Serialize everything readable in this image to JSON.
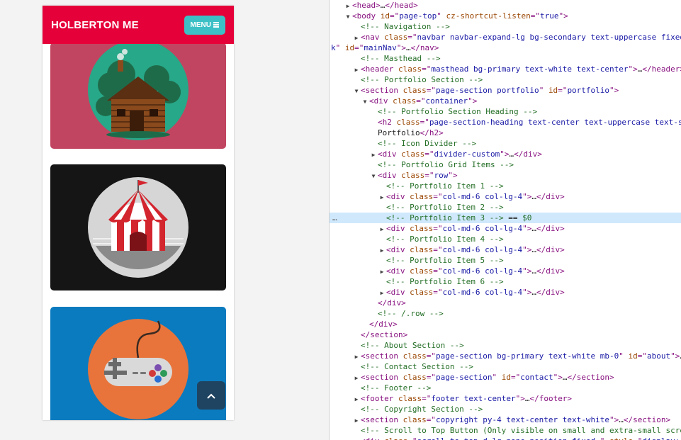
{
  "viewport": {
    "brand": "HOLBERTON ME",
    "menu_label": "MENU",
    "scroll_top_icon": "chevron-up-icon",
    "cards": [
      {
        "name": "cabin",
        "bg": "#c14561",
        "circle": "#27a888"
      },
      {
        "name": "circus",
        "bg": "#151515",
        "circle": "#d6d6d6"
      },
      {
        "name": "game-controller",
        "bg": "#0b7bbf",
        "circle": "#e8743b"
      }
    ]
  },
  "dom_lines": [
    {
      "indent": 1,
      "tw": "▶",
      "html": [
        [
          "tag",
          "<head>"
        ],
        [
          "txt",
          "…"
        ],
        [
          "tag",
          "</head>"
        ]
      ]
    },
    {
      "indent": 1,
      "tw": "▼",
      "html": [
        [
          "tag",
          "<body "
        ],
        [
          "attr",
          "id"
        ],
        [
          "tag",
          "=\""
        ],
        [
          "val",
          "page-top"
        ],
        [
          "tag",
          "\" "
        ],
        [
          "attr",
          "cz-shortcut-listen"
        ],
        [
          "tag",
          "=\""
        ],
        [
          "val",
          "true"
        ],
        [
          "tag",
          "\">"
        ]
      ]
    },
    {
      "indent": 2,
      "tw": "",
      "html": [
        [
          "cmt",
          "<!-- Navigation -->"
        ]
      ]
    },
    {
      "indent": 2,
      "tw": "▶",
      "html": [
        [
          "tag",
          "<nav "
        ],
        [
          "attr",
          "class"
        ],
        [
          "tag",
          "=\""
        ],
        [
          "val",
          "navbar navbar-expand-lg bg-secondary text-uppercase fixed-"
        ]
      ]
    },
    {
      "indent": 0,
      "tw": "",
      "html": [
        [
          "val",
          "k"
        ],
        [
          "tag",
          "\" "
        ],
        [
          "attr",
          "id"
        ],
        [
          "tag",
          "=\""
        ],
        [
          "val",
          "mainNav"
        ],
        [
          "tag",
          "\">"
        ],
        [
          "txt",
          "…"
        ],
        [
          "tag",
          "</nav>"
        ]
      ],
      "pad": 2
    },
    {
      "indent": 2,
      "tw": "",
      "html": [
        [
          "cmt",
          "<!-- Masthead -->"
        ]
      ]
    },
    {
      "indent": 2,
      "tw": "▶",
      "html": [
        [
          "tag",
          "<header "
        ],
        [
          "attr",
          "class"
        ],
        [
          "tag",
          "=\""
        ],
        [
          "val",
          "masthead bg-primary text-white text-center"
        ],
        [
          "tag",
          "\">"
        ],
        [
          "txt",
          "…"
        ],
        [
          "tag",
          "</header>"
        ]
      ]
    },
    {
      "indent": 2,
      "tw": "",
      "html": [
        [
          "cmt",
          "<!-- Portfolio Section -->"
        ]
      ]
    },
    {
      "indent": 2,
      "tw": "▼",
      "html": [
        [
          "tag",
          "<section "
        ],
        [
          "attr",
          "class"
        ],
        [
          "tag",
          "=\""
        ],
        [
          "val",
          "page-section portfolio"
        ],
        [
          "tag",
          "\" "
        ],
        [
          "attr",
          "id"
        ],
        [
          "tag",
          "=\""
        ],
        [
          "val",
          "portfolio"
        ],
        [
          "tag",
          "\">"
        ]
      ]
    },
    {
      "indent": 3,
      "tw": "▼",
      "html": [
        [
          "tag",
          "<div "
        ],
        [
          "attr",
          "class"
        ],
        [
          "tag",
          "=\""
        ],
        [
          "val",
          "container"
        ],
        [
          "tag",
          "\">"
        ]
      ]
    },
    {
      "indent": 4,
      "tw": "",
      "html": [
        [
          "cmt",
          "<!-- Portfolio Section Heading -->"
        ]
      ]
    },
    {
      "indent": 4,
      "tw": "",
      "html": [
        [
          "tag",
          "<h2 "
        ],
        [
          "attr",
          "class"
        ],
        [
          "tag",
          "=\""
        ],
        [
          "val",
          "page-section-heading text-center text-uppercase text-se"
        ]
      ]
    },
    {
      "indent": 4,
      "tw": "",
      "html": [
        [
          "txt",
          "Portfolio"
        ],
        [
          "tag",
          "</h2>"
        ]
      ]
    },
    {
      "indent": 4,
      "tw": "",
      "html": [
        [
          "cmt",
          "<!-- Icon Divider -->"
        ]
      ]
    },
    {
      "indent": 4,
      "tw": "▶",
      "html": [
        [
          "tag",
          "<div "
        ],
        [
          "attr",
          "class"
        ],
        [
          "tag",
          "=\""
        ],
        [
          "val",
          "divider-custom"
        ],
        [
          "tag",
          "\">"
        ],
        [
          "txt",
          "…"
        ],
        [
          "tag",
          "</div>"
        ]
      ]
    },
    {
      "indent": 4,
      "tw": "",
      "html": [
        [
          "cmt",
          "<!-- Portfolio Grid Items -->"
        ]
      ]
    },
    {
      "indent": 4,
      "tw": "▼",
      "html": [
        [
          "tag",
          "<div "
        ],
        [
          "attr",
          "class"
        ],
        [
          "tag",
          "=\""
        ],
        [
          "val",
          "row"
        ],
        [
          "tag",
          "\">"
        ]
      ]
    },
    {
      "indent": 5,
      "tw": "",
      "html": [
        [
          "cmt",
          "<!-- Portfolio Item 1 -->"
        ]
      ]
    },
    {
      "indent": 5,
      "tw": "▶",
      "html": [
        [
          "tag",
          "<div "
        ],
        [
          "attr",
          "class"
        ],
        [
          "tag",
          "=\""
        ],
        [
          "val",
          "col-md-6 col-lg-4"
        ],
        [
          "tag",
          "\">"
        ],
        [
          "txt",
          "…"
        ],
        [
          "tag",
          "</div>"
        ]
      ]
    },
    {
      "indent": 5,
      "tw": "",
      "html": [
        [
          "cmt",
          "<!-- Portfolio Item 2 -->"
        ]
      ]
    },
    {
      "indent": 5,
      "tw": "",
      "html": [
        [
          "cmt",
          "<!-- Portfolio Item 3 -->"
        ],
        [
          "txt",
          " == "
        ],
        [
          "cmt",
          "$0"
        ]
      ],
      "selected": true
    },
    {
      "indent": 5,
      "tw": "▶",
      "html": [
        [
          "tag",
          "<div "
        ],
        [
          "attr",
          "class"
        ],
        [
          "tag",
          "=\""
        ],
        [
          "val",
          "col-md-6 col-lg-4"
        ],
        [
          "tag",
          "\">"
        ],
        [
          "txt",
          "…"
        ],
        [
          "tag",
          "</div>"
        ]
      ]
    },
    {
      "indent": 5,
      "tw": "",
      "html": [
        [
          "cmt",
          "<!-- Portfolio Item 4 -->"
        ]
      ]
    },
    {
      "indent": 5,
      "tw": "▶",
      "html": [
        [
          "tag",
          "<div "
        ],
        [
          "attr",
          "class"
        ],
        [
          "tag",
          "=\""
        ],
        [
          "val",
          "col-md-6 col-lg-4"
        ],
        [
          "tag",
          "\">"
        ],
        [
          "txt",
          "…"
        ],
        [
          "tag",
          "</div>"
        ]
      ]
    },
    {
      "indent": 5,
      "tw": "",
      "html": [
        [
          "cmt",
          "<!-- Portfolio Item 5 -->"
        ]
      ]
    },
    {
      "indent": 5,
      "tw": "▶",
      "html": [
        [
          "tag",
          "<div "
        ],
        [
          "attr",
          "class"
        ],
        [
          "tag",
          "=\""
        ],
        [
          "val",
          "col-md-6 col-lg-4"
        ],
        [
          "tag",
          "\">"
        ],
        [
          "txt",
          "…"
        ],
        [
          "tag",
          "</div>"
        ]
      ]
    },
    {
      "indent": 5,
      "tw": "",
      "html": [
        [
          "cmt",
          "<!-- Portfolio Item 6 -->"
        ]
      ]
    },
    {
      "indent": 5,
      "tw": "▶",
      "html": [
        [
          "tag",
          "<div "
        ],
        [
          "attr",
          "class"
        ],
        [
          "tag",
          "=\""
        ],
        [
          "val",
          "col-md-6 col-lg-4"
        ],
        [
          "tag",
          "\">"
        ],
        [
          "txt",
          "…"
        ],
        [
          "tag",
          "</div>"
        ]
      ]
    },
    {
      "indent": 4,
      "tw": "",
      "html": [
        [
          "tag",
          "</div>"
        ]
      ]
    },
    {
      "indent": 4,
      "tw": "",
      "html": [
        [
          "cmt",
          "<!-- /.row -->"
        ]
      ]
    },
    {
      "indent": 3,
      "tw": "",
      "html": [
        [
          "tag",
          "</div>"
        ]
      ]
    },
    {
      "indent": 2,
      "tw": "",
      "html": [
        [
          "tag",
          "</section>"
        ]
      ]
    },
    {
      "indent": 2,
      "tw": "",
      "html": [
        [
          "cmt",
          "<!-- About Section -->"
        ]
      ]
    },
    {
      "indent": 2,
      "tw": "▶",
      "html": [
        [
          "tag",
          "<section "
        ],
        [
          "attr",
          "class"
        ],
        [
          "tag",
          "=\""
        ],
        [
          "val",
          "page-section bg-primary text-white mb-0"
        ],
        [
          "tag",
          "\" "
        ],
        [
          "attr",
          "id"
        ],
        [
          "tag",
          "=\""
        ],
        [
          "val",
          "about"
        ],
        [
          "tag",
          "\">"
        ],
        [
          "txt",
          "…"
        ]
      ]
    },
    {
      "indent": 2,
      "tw": "",
      "html": [
        [
          "cmt",
          "<!-- Contact Section -->"
        ]
      ]
    },
    {
      "indent": 2,
      "tw": "▶",
      "html": [
        [
          "tag",
          "<section "
        ],
        [
          "attr",
          "class"
        ],
        [
          "tag",
          "=\""
        ],
        [
          "val",
          "page-section"
        ],
        [
          "tag",
          "\" "
        ],
        [
          "attr",
          "id"
        ],
        [
          "tag",
          "=\""
        ],
        [
          "val",
          "contact"
        ],
        [
          "tag",
          "\">"
        ],
        [
          "txt",
          "…"
        ],
        [
          "tag",
          "</section>"
        ]
      ]
    },
    {
      "indent": 2,
      "tw": "",
      "html": [
        [
          "cmt",
          "<!-- Footer -->"
        ]
      ]
    },
    {
      "indent": 2,
      "tw": "▶",
      "html": [
        [
          "tag",
          "<footer "
        ],
        [
          "attr",
          "class"
        ],
        [
          "tag",
          "=\""
        ],
        [
          "val",
          "footer text-center"
        ],
        [
          "tag",
          "\">"
        ],
        [
          "txt",
          "…"
        ],
        [
          "tag",
          "</footer>"
        ]
      ]
    },
    {
      "indent": 2,
      "tw": "",
      "html": [
        [
          "cmt",
          "<!-- Copyright Section -->"
        ]
      ]
    },
    {
      "indent": 2,
      "tw": "▶",
      "html": [
        [
          "tag",
          "<section "
        ],
        [
          "attr",
          "class"
        ],
        [
          "tag",
          "=\""
        ],
        [
          "val",
          "copyright py-4 text-center text-white"
        ],
        [
          "tag",
          "\">"
        ],
        [
          "txt",
          "…"
        ],
        [
          "tag",
          "</section>"
        ]
      ]
    },
    {
      "indent": 2,
      "tw": "",
      "html": [
        [
          "cmt",
          "<!-- Scroll to Top Button (Only visible on small and extra-small scre"
        ]
      ]
    },
    {
      "indent": 2,
      "tw": "▶",
      "html": [
        [
          "tag",
          "<div "
        ],
        [
          "attr",
          "class"
        ],
        [
          "tag",
          "=\""
        ],
        [
          "val",
          "scroll-to-top d-lg-none position-fixed "
        ],
        [
          "tag",
          "\" "
        ],
        [
          "attr",
          "style"
        ],
        [
          "tag",
          "=\""
        ],
        [
          "val",
          "display: b"
        ]
      ]
    }
  ],
  "selected_ellipsis": "…"
}
